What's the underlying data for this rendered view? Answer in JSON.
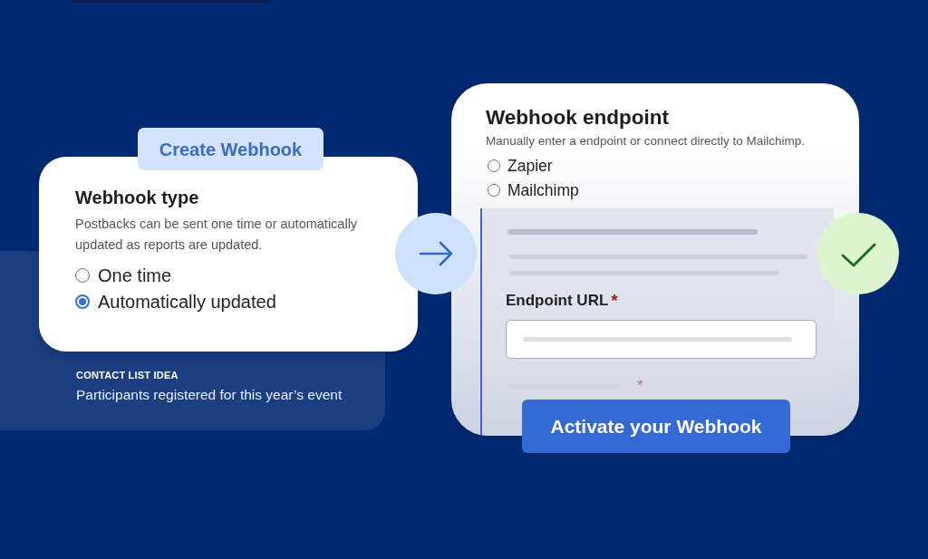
{
  "type_card": {
    "badge": "Create Webhook",
    "title": "Webhook type",
    "description": "Postbacks can be sent one time or automatically updated as reports are updated.",
    "options": [
      {
        "label": "One time",
        "selected": false
      },
      {
        "label": "Automatically updated",
        "selected": true
      }
    ]
  },
  "tip": {
    "heading": "CONTACT LIST IDEA",
    "text": "Participants registered for this year’s event"
  },
  "endpoint_card": {
    "title": "Webhook endpoint",
    "description": "Manually enter a endpoint or connect directly to Mailchimp.",
    "options": [
      {
        "label": "Zapier",
        "selected": false
      },
      {
        "label": "Mailchimp",
        "selected": false
      }
    ],
    "field": {
      "label": "Endpoint URL",
      "required_mark": "*"
    },
    "faded_field": {
      "required_mark": "*"
    },
    "button": "Activate your Webhook"
  }
}
